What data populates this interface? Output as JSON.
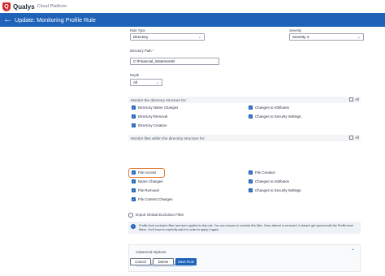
{
  "topbar": {
    "brand": "Qualys",
    "sub": "Cloud Platform",
    "logo_letter": "Q"
  },
  "header": {
    "back_icon": "←",
    "title": "Update: Monitoring Profile Rule"
  },
  "rule_type": {
    "label": "Rule Type",
    "value": "Directory"
  },
  "severity": {
    "label": "Severity",
    "value": "Severity 3"
  },
  "directory_path": {
    "label": "Directory Path *",
    "value": "C:\\Financial_Statements\\"
  },
  "depth": {
    "label": "Depth",
    "value": "All"
  },
  "monitor_structure": {
    "heading": "Monitor the directory structure for:",
    "all_label": "All",
    "left": [
      "Directory Name Changes",
      "Directory Removal",
      "Directory Creation"
    ],
    "right": [
      "Changes to Attributes",
      "Changes to Security Settings"
    ]
  },
  "monitor_files": {
    "heading": "Monitor files within the directory structure for:",
    "all_label": "All",
    "left": [
      "File Access",
      "Name Changes",
      "File Removal",
      "File Content Changes"
    ],
    "right": [
      "File Creation",
      "Changes to Attributes",
      "Changes to Security Settings"
    ]
  },
  "import_filter": {
    "label": "Import Global Exclusion Filter"
  },
  "notice": {
    "text": "Profile level exclusion filter has been applied to this rule. You can choose to override this filter. Once altered or removed, it doesn't get synced with the Profile level filters. You'll have to explicitly add it in order to apply it again."
  },
  "advanced": {
    "title": "Advanced Options",
    "filter_button": "New Inclusion / Exclusion Filter"
  },
  "buttons": {
    "cancel": "Cancel",
    "delete": "Delete",
    "save": "Save Rule"
  },
  "colors": {
    "brand_red": "#d7282f",
    "header_blue": "#1f63b8",
    "highlight_orange": "#e07a3a"
  }
}
